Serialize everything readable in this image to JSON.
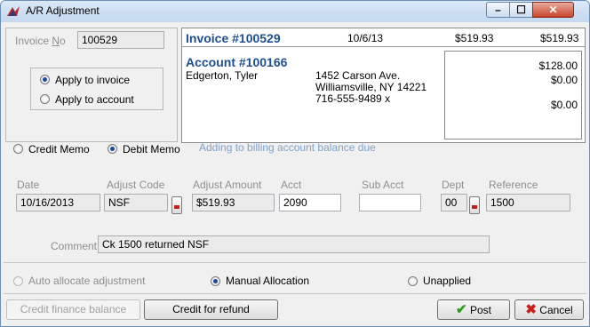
{
  "window": {
    "title": "A/R Adjustment",
    "icon": "ar-adjustment-icon",
    "controls": {
      "minimize": "–",
      "maximize": "☐",
      "close": "✕"
    }
  },
  "invoice_no": {
    "label_prefix": "Invoice ",
    "label_underlined": "N",
    "label_suffix": "o",
    "value": "100529"
  },
  "apply_options": [
    {
      "label": "Apply to invoice",
      "selected": true
    },
    {
      "label": "Apply to account",
      "selected": false
    }
  ],
  "invoice_header": {
    "title": "Invoice #100529",
    "date": "10/6/13",
    "amount1": "$519.93",
    "amount2": "$519.93"
  },
  "account": {
    "title": "Account #100166",
    "name": "Edgerton, Tyler",
    "address1": "1452 Carson Ave.",
    "address2": "Williamsville, NY  14221",
    "phone": "716-555-9489 x",
    "amounts": [
      "$128.00",
      "$0.00",
      "$0.00"
    ]
  },
  "memo_type": {
    "options": [
      {
        "label": "Credit Memo",
        "selected": false
      },
      {
        "label": "Debit Memo",
        "selected": true
      }
    ],
    "hint": "Adding to billing account balance due"
  },
  "fields": {
    "date": {
      "label": "Date",
      "value": "10/16/2013"
    },
    "adjust_code": {
      "label": "Adjust Code",
      "value": "NSF"
    },
    "adjust_amount": {
      "label": "Adjust Amount",
      "value": "$519.93"
    },
    "acct": {
      "label": "Acct",
      "value": "2090"
    },
    "sub_acct": {
      "label": "Sub Acct",
      "value": ""
    },
    "dept": {
      "label": "Dept",
      "value": "00"
    },
    "reference": {
      "label": "Reference",
      "value": "1500"
    },
    "comment": {
      "label": "Comment",
      "value": "Ck 1500 returned NSF"
    }
  },
  "allocation": [
    {
      "label": "Auto allocate adjustment",
      "selected": false,
      "disabled": true
    },
    {
      "label": "Manual Allocation",
      "selected": true,
      "disabled": false
    },
    {
      "label": "Unapplied",
      "selected": false,
      "disabled": false
    }
  ],
  "buttons": {
    "credit_finance": "Credit finance balance",
    "credit_refund": "Credit for refund",
    "post": "Post",
    "cancel": "Cancel"
  },
  "colors": {
    "accent": "#1e4f92",
    "hint": "#7ea3cf",
    "post_check": "#2e9a1e",
    "cancel_x": "#c8201c"
  }
}
